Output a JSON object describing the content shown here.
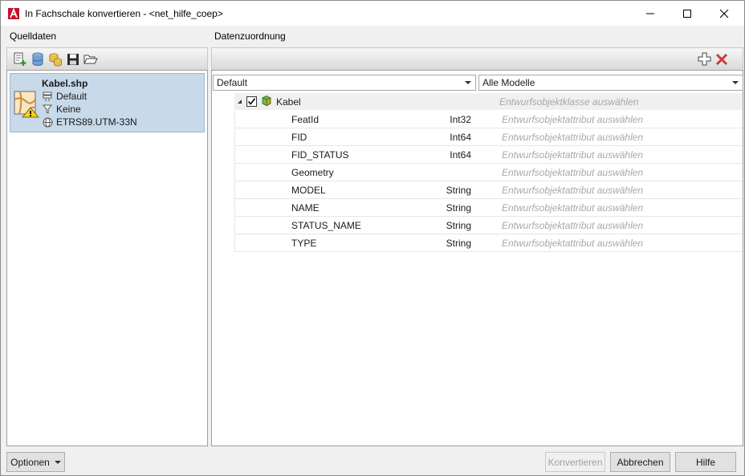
{
  "window": {
    "title": "In Fachschale konvertieren - <net_hilfe_coep>"
  },
  "left": {
    "label": "Quelldaten",
    "toolbar_icons": [
      "add-source-icon",
      "database-icon",
      "database-stack-icon",
      "save-icon",
      "open-folder-icon"
    ],
    "source": {
      "name": "Kabel.shp",
      "schema": "Default",
      "filter": "Keine",
      "crs": "ETRS89.UTM-33N"
    }
  },
  "right": {
    "label": "Datenzuordnung",
    "combo_left": "Default",
    "combo_right": "Alle Modelle",
    "root": {
      "label": "Kabel",
      "checked": true,
      "hint": "Entwurfsobjektklasse auswählen"
    },
    "attr_hint": "Entwurfsobjektattribut auswählen",
    "rows": [
      {
        "name": "FeatId",
        "type": "Int32"
      },
      {
        "name": "FID",
        "type": "Int64"
      },
      {
        "name": "FID_STATUS",
        "type": "Int64"
      },
      {
        "name": "Geometry",
        "type": ""
      },
      {
        "name": "MODEL",
        "type": "String"
      },
      {
        "name": "NAME",
        "type": "String"
      },
      {
        "name": "STATUS_NAME",
        "type": "String"
      },
      {
        "name": "TYPE",
        "type": "String"
      }
    ]
  },
  "buttons": {
    "options": "Optionen",
    "convert": "Konvertieren",
    "cancel": "Abbrechen",
    "help": "Hilfe"
  },
  "colors": {
    "selection": "#c8d9ea",
    "hint": "#a8a8a8",
    "delete": "#d03a3a",
    "app_red": "#c8102e"
  }
}
